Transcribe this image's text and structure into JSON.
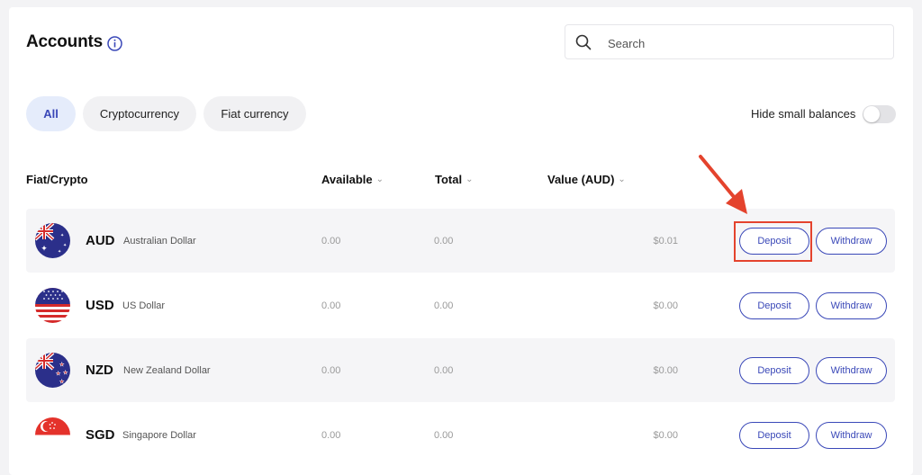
{
  "page": {
    "title": "Accounts",
    "search_placeholder": "Search"
  },
  "filters": [
    {
      "label": "All",
      "active": true
    },
    {
      "label": "Cryptocurrency",
      "active": false
    },
    {
      "label": "Fiat currency",
      "active": false
    }
  ],
  "toggle": {
    "label": "Hide small balances",
    "on": false
  },
  "columns": {
    "asset": "Fiat/Crypto",
    "available": "Available",
    "total": "Total",
    "value": "Value (AUD)"
  },
  "rows": [
    {
      "code": "AUD",
      "name": "Australian Dollar",
      "available": "0.00",
      "total": "0.00",
      "value": "$0.01",
      "deposit": "Deposit",
      "withdraw": "Withdraw"
    },
    {
      "code": "USD",
      "name": "US Dollar",
      "available": "0.00",
      "total": "0.00",
      "value": "$0.00",
      "deposit": "Deposit",
      "withdraw": "Withdraw"
    },
    {
      "code": "NZD",
      "name": "New Zealand Dollar",
      "available": "0.00",
      "total": "0.00",
      "value": "$0.00",
      "deposit": "Deposit",
      "withdraw": "Withdraw"
    },
    {
      "code": "SGD",
      "name": "Singapore Dollar",
      "available": "0.00",
      "total": "0.00",
      "value": "$0.00",
      "deposit": "Deposit",
      "withdraw": "Withdraw"
    }
  ],
  "colors": {
    "accent": "#3a48b8",
    "annotation": "#e4432d",
    "row_shade": "#f5f5f7"
  },
  "icons": {
    "info": "info-icon",
    "search": "search-icon",
    "sort": "chevron-down-icon"
  }
}
